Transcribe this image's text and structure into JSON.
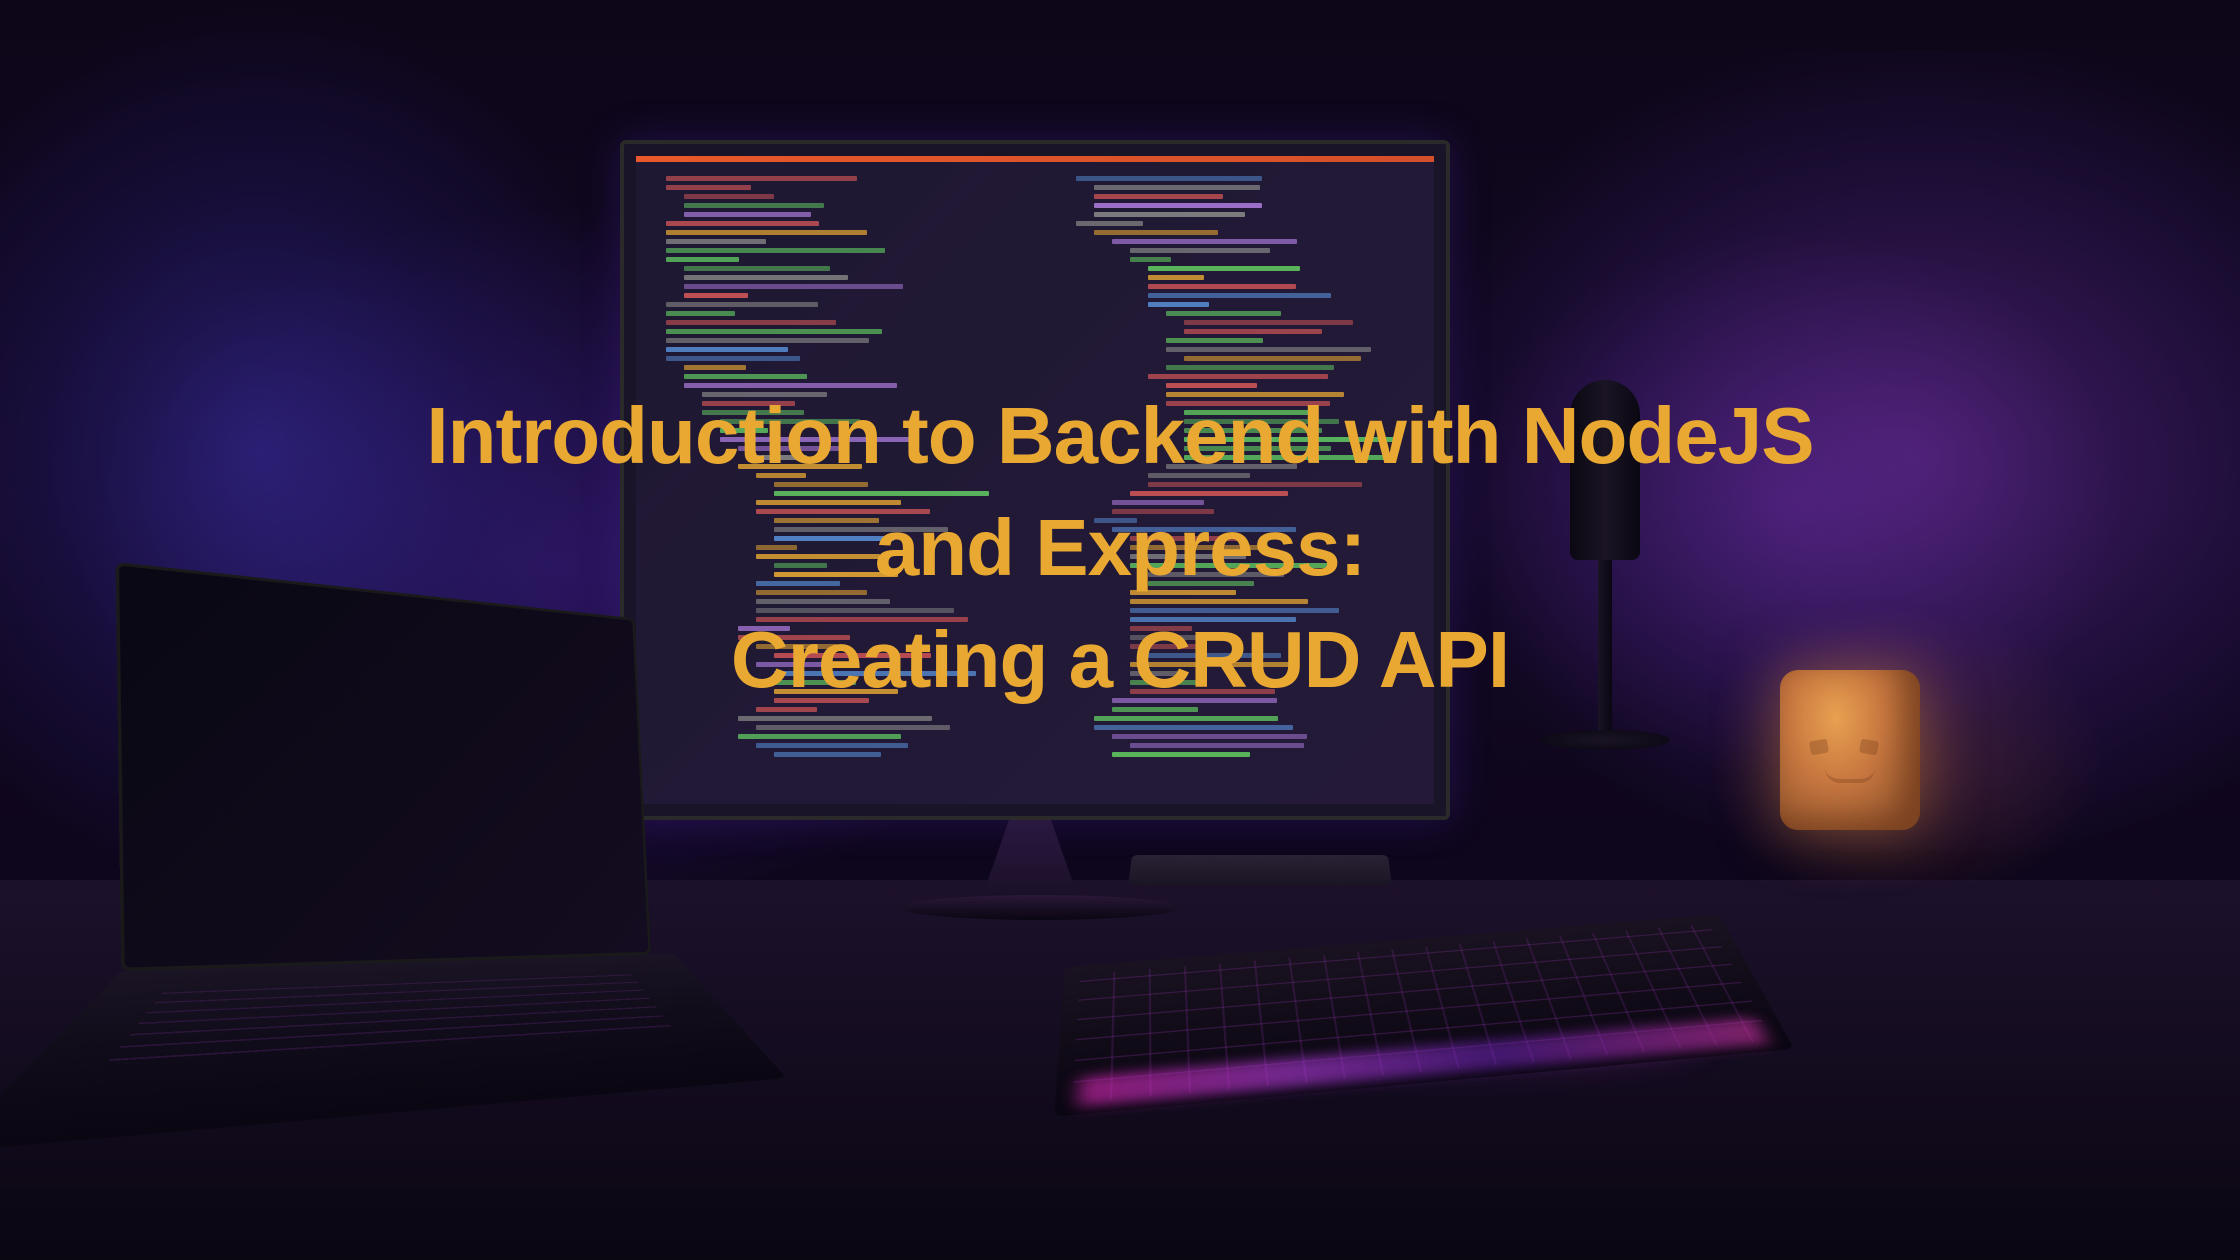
{
  "title": {
    "line1": "Introduction to Backend with NodeJS",
    "line2": "and Express:",
    "line3": "Creating a CRUD API"
  },
  "colors": {
    "title_text": "#e8a832",
    "rgb_magenta": "#dc28b4",
    "rgb_purple": "#7828c8",
    "candle_glow": "#e8a050"
  }
}
